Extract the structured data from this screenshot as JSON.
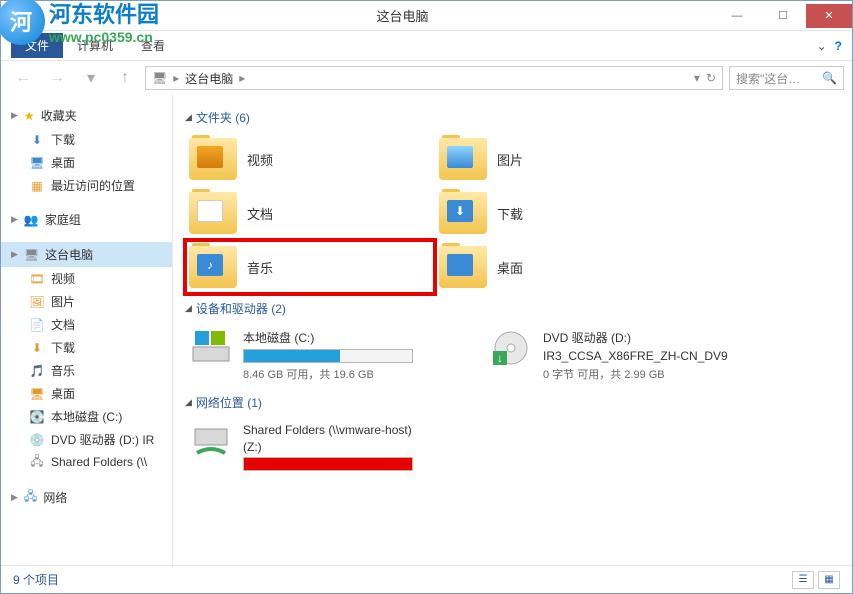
{
  "watermark": {
    "title": "河东软件园",
    "url": "www.pc0359.cn"
  },
  "window": {
    "title": "这台电脑"
  },
  "ribbon": {
    "file": "文件",
    "tabs": [
      "计算机",
      "查看"
    ],
    "help": "?"
  },
  "nav": {
    "back_icon": "←",
    "fwd_icon": "→",
    "hist_icon": "▾",
    "up_icon": "↑",
    "refresh_icon": "↻"
  },
  "address": {
    "root": "这台电脑",
    "sep": "▸"
  },
  "search": {
    "placeholder": "搜索\"这台…"
  },
  "sidebar": {
    "favorites": {
      "label": "收藏夹",
      "items": [
        {
          "label": "下载"
        },
        {
          "label": "桌面"
        },
        {
          "label": "最近访问的位置"
        }
      ]
    },
    "homegroup": {
      "label": "家庭组"
    },
    "thispc": {
      "label": "这台电脑",
      "items": [
        {
          "label": "视频"
        },
        {
          "label": "图片"
        },
        {
          "label": "文档"
        },
        {
          "label": "下载"
        },
        {
          "label": "音乐"
        },
        {
          "label": "桌面"
        },
        {
          "label": "本地磁盘 (C:)"
        },
        {
          "label": "DVD 驱动器 (D:) IR"
        },
        {
          "label": "Shared Folders (\\\\"
        }
      ]
    },
    "network": {
      "label": "网络"
    }
  },
  "sections": {
    "folders": {
      "title": "文件夹 (6)",
      "items": [
        {
          "label": "视频"
        },
        {
          "label": "图片"
        },
        {
          "label": "文档"
        },
        {
          "label": "下载"
        },
        {
          "label": "音乐"
        },
        {
          "label": "桌面"
        }
      ]
    },
    "devices": {
      "title": "设备和驱动器 (2)",
      "items": [
        {
          "name": "本地磁盘 (C:)",
          "sub": "8.46 GB 可用，共 19.6 GB",
          "fill_pct": 57,
          "fill_color": "#26a0da"
        },
        {
          "name": "DVD 驱动器 (D:)",
          "name2": "IR3_CCSA_X86FRE_ZH-CN_DV9",
          "sub": "0 字节 可用，共 2.99 GB"
        }
      ]
    },
    "netloc": {
      "title": "网络位置 (1)",
      "items": [
        {
          "name": "Shared Folders (\\\\vmware-host)",
          "name2": "(Z:)",
          "fill_pct": 100,
          "fill_color": "#e60000"
        }
      ]
    }
  },
  "statusbar": {
    "count": "9 个项目"
  }
}
